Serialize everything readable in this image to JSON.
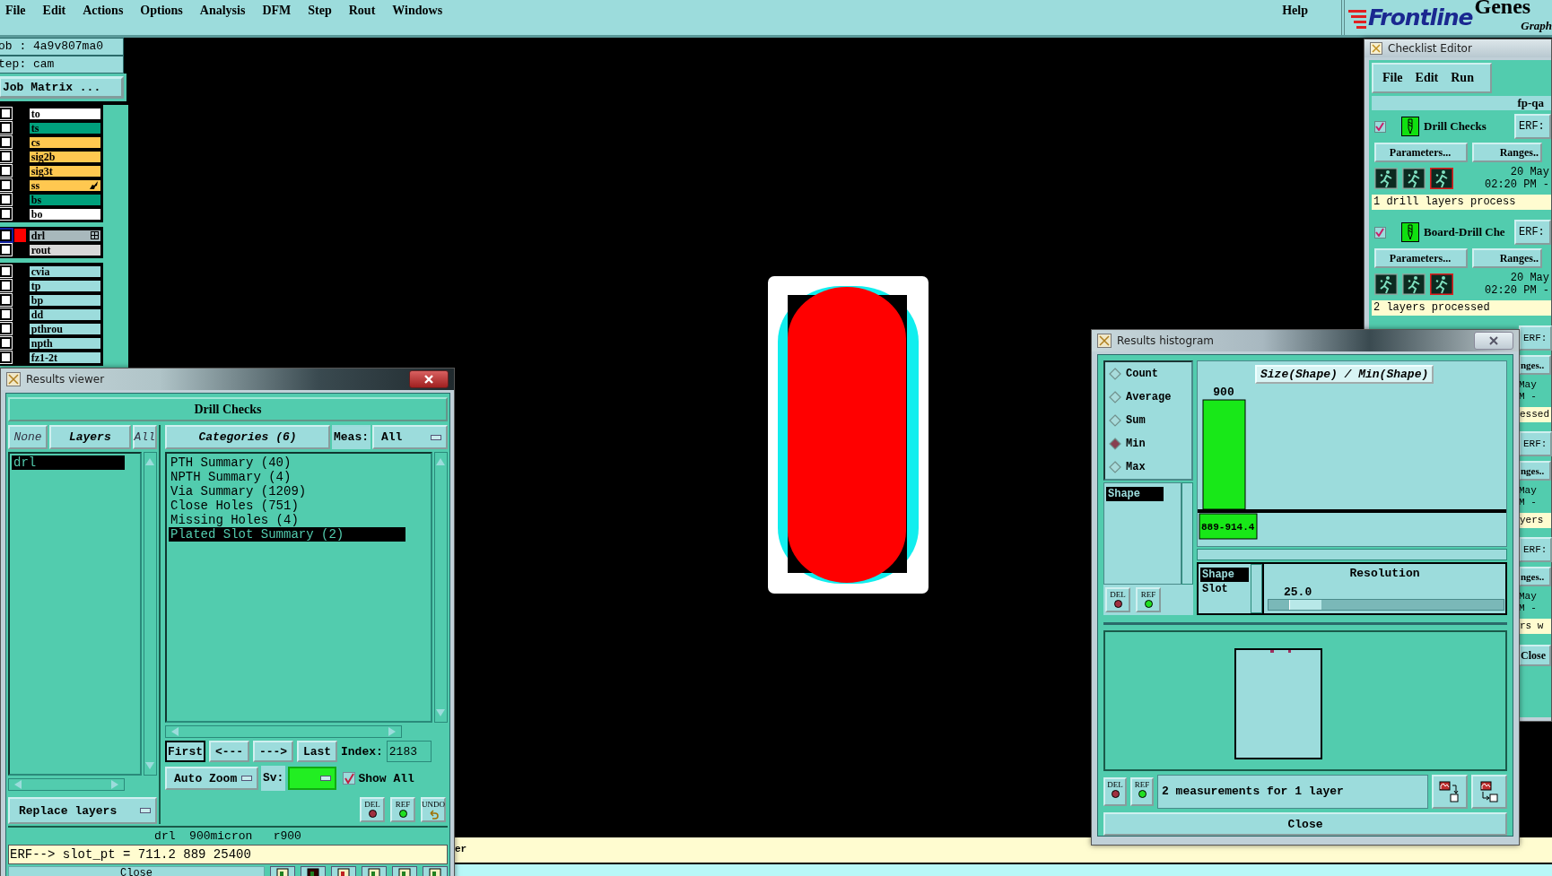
{
  "menu_bar": {
    "items": [
      "File",
      "Edit",
      "Actions",
      "Options",
      "Analysis",
      "DFM",
      "Step",
      "Rout",
      "Windows"
    ],
    "help": "Help"
  },
  "logo": {
    "brand": "Frontline",
    "product": "Genes",
    "tagline": "Graph"
  },
  "job_panel": {
    "job": "ob : 4a9v807ma0",
    "step": "tep: cam",
    "matrix_button": "Job Matrix ..."
  },
  "layer_groups": [
    {
      "layers": [
        {
          "name": "to",
          "color": "#ffffff",
          "checked": false,
          "active": false
        },
        {
          "name": "ts",
          "color": "#00a07c",
          "checked": false,
          "active": false
        },
        {
          "name": "cs",
          "color": "#ffc850",
          "checked": false,
          "active": false
        },
        {
          "name": "sig2b",
          "color": "#ffc850",
          "checked": false,
          "active": false
        },
        {
          "name": "sig3t",
          "color": "#ffc850",
          "checked": false,
          "active": false
        },
        {
          "name": "ss",
          "color": "#ffc850",
          "checked": false,
          "active": false,
          "kind": "pointer"
        },
        {
          "name": "bs",
          "color": "#00a07c",
          "checked": false,
          "active": false
        },
        {
          "name": "bo",
          "color": "#ffffff",
          "checked": false,
          "active": false
        }
      ]
    },
    {
      "layers": [
        {
          "name": "drl",
          "color": "#a8b8bc",
          "checked": false,
          "active": true,
          "kind": "grid"
        },
        {
          "name": "rout",
          "color": "#d8d8d8",
          "checked": false,
          "active": false
        }
      ]
    },
    {
      "layers": [
        {
          "name": "cvia",
          "color": "#9cdcdc",
          "checked": false,
          "active": false
        },
        {
          "name": "tp",
          "color": "#9cdcdc",
          "checked": false,
          "active": false
        },
        {
          "name": "bp",
          "color": "#9cdcdc",
          "checked": false,
          "active": false
        },
        {
          "name": "dd",
          "color": "#9cdcdc",
          "checked": false,
          "active": false
        },
        {
          "name": "pthrou",
          "color": "#9cdcdc",
          "checked": false,
          "active": false
        },
        {
          "name": "npth",
          "color": "#9cdcdc",
          "checked": false,
          "active": false
        },
        {
          "name": "fz1-2t",
          "color": "#9cdcdc",
          "checked": false,
          "active": false
        }
      ]
    }
  ],
  "status_bar": {
    "text": "er"
  },
  "results_viewer": {
    "title": "Results viewer",
    "header": "Drill Checks",
    "layer_buttons": [
      {
        "label": "None",
        "disabled": true
      },
      {
        "label": "Layers",
        "disabled": false
      },
      {
        "label": "All",
        "disabled": true
      }
    ],
    "layers": [
      {
        "name": "drl",
        "selected": true
      }
    ],
    "categories_button": "Categories (6)",
    "meas_label": "Meas:",
    "meas_value": "All",
    "categories": [
      {
        "label": "PTH Summary (40)",
        "selected": false
      },
      {
        "label": "NPTH Summary (4)",
        "selected": false
      },
      {
        "label": "Via Summary (1209)",
        "selected": false
      },
      {
        "label": "Close Holes (751)",
        "selected": false
      },
      {
        "label": "Missing Holes (4)",
        "selected": false
      },
      {
        "label": "Plated Slot Summary (2)",
        "selected": true
      }
    ],
    "nav_buttons": [
      "First",
      "<---",
      "--->",
      "Last"
    ],
    "index_label": "Index:",
    "index_value": "2183",
    "auto_zoom": "Auto Zoom",
    "sv_label": "Sv:",
    "show_all": {
      "label": "Show All",
      "checked": true
    },
    "replace_layers": "Replace layers",
    "tool_buttons": [
      {
        "label": "DEL",
        "kind": "del"
      },
      {
        "label": "REF",
        "kind": "ref"
      },
      {
        "label": "UNDO",
        "kind": "undo"
      }
    ],
    "info": "drl  900micron   r900",
    "erf": "ERF--> slot_pt = 711.2 889 25400",
    "close": "Close"
  },
  "histogram": {
    "title": "Results histogram",
    "modes": [
      {
        "label": "Count",
        "selected": false
      },
      {
        "label": "Average",
        "selected": false
      },
      {
        "label": "Sum",
        "selected": false
      },
      {
        "label": "Min",
        "selected": true
      },
      {
        "label": "Max",
        "selected": false
      }
    ],
    "fields": [
      {
        "label": "Shape",
        "selected": true
      }
    ],
    "left_buttons": [
      {
        "label": "DEL",
        "kind": "del"
      },
      {
        "label": "REF",
        "kind": "ref"
      }
    ],
    "chart_title": "Size(Shape) / Min(Shape)",
    "bins": [
      {
        "value": "900",
        "range": "889-914.4"
      }
    ],
    "subfields": [
      {
        "label": "Shape",
        "selected": true
      },
      {
        "label": "Slot",
        "selected": false
      }
    ],
    "resolution_label": "Resolution",
    "resolution_value": "25.0",
    "resolution_slider": {
      "level": 0.1
    },
    "bottom_buttons": [
      {
        "label": "DEL",
        "kind": "del"
      },
      {
        "label": "REF",
        "kind": "ref"
      }
    ],
    "summary": "2 measurements for 1 layer",
    "close": "Close"
  },
  "checklist": {
    "title": "Checklist Editor",
    "menu": [
      "File",
      "Edit",
      "Run"
    ],
    "name": "fp-qa",
    "checks": [
      {
        "kind": "full",
        "name": "Drill Checks",
        "checked": true,
        "erf": "ERF:",
        "parameters": "Parameters...",
        "ranges": "Ranges..",
        "date": "20 May",
        "time": "02:20 PM -",
        "status": "1 drill layers process"
      },
      {
        "kind": "full",
        "name": "Board-Drill Che",
        "checked": true,
        "erf": "ERF:",
        "parameters": "Parameters...",
        "ranges": "Ranges..",
        "date": "20 May",
        "time": "02:20 PM -",
        "status": "2 layers processed"
      },
      {
        "kind": "partial",
        "erf": "ERF:",
        "ranges": "nges..",
        "date": "May",
        "time": "M -",
        "status": "essed"
      },
      {
        "kind": "partial",
        "erf": "ERF:",
        "ranges": "nges..",
        "date": "May",
        "time": "M -",
        "status": "yers"
      },
      {
        "kind": "partial",
        "erf": "ERF:",
        "ranges": "nges..",
        "date": "May",
        "time": "M -",
        "status": "rs w"
      }
    ],
    "close": "Close"
  }
}
